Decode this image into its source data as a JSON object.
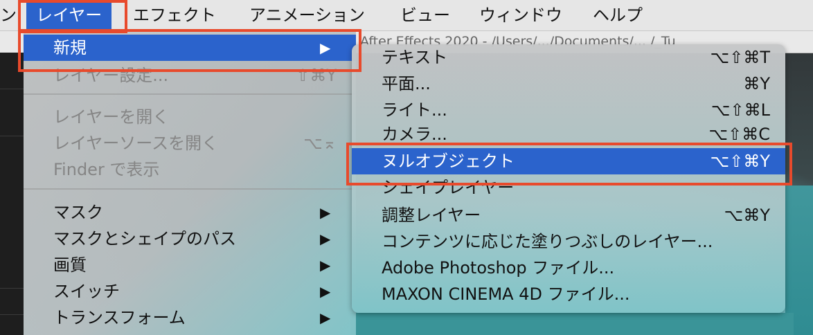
{
  "menubar": {
    "items": [
      {
        "label": "ン"
      },
      {
        "label": "レイヤー"
      },
      {
        "label": "エフェクト"
      },
      {
        "label": "アニメーション"
      },
      {
        "label": "ビュー"
      },
      {
        "label": "ウィンドウ"
      },
      {
        "label": "ヘルプ"
      }
    ]
  },
  "title_strip": {
    "text": "After Effects 2020 - /Users/.../Documents/... /_Tu"
  },
  "layer_menu": {
    "items": [
      {
        "label": "新規",
        "shortcut": "",
        "submenu": true,
        "highlighted": true
      },
      {
        "label": "レイヤー設定...",
        "shortcut": "⇧⌘Y",
        "disabled": true
      },
      {
        "label": "レイヤーを開く",
        "shortcut": "",
        "disabled": true
      },
      {
        "label": "レイヤーソースを開く",
        "shortcut": "⌥⌅",
        "disabled": true
      },
      {
        "label": "Finder で表示",
        "shortcut": "",
        "disabled": true
      },
      {
        "label": "マスク",
        "submenu": true
      },
      {
        "label": "マスクとシェイプのパス",
        "submenu": true
      },
      {
        "label": "画質",
        "submenu": true
      },
      {
        "label": "スイッチ",
        "submenu": true
      },
      {
        "label": "トランスフォーム",
        "submenu": true
      }
    ],
    "arrow": "▶"
  },
  "new_submenu": {
    "items": [
      {
        "label": "テキスト",
        "shortcut": "⌥⇧⌘T"
      },
      {
        "label": "平面...",
        "shortcut": "⌘Y"
      },
      {
        "label": "ライト...",
        "shortcut": "⌥⇧⌘L"
      },
      {
        "label": "カメラ...",
        "shortcut": "⌥⇧⌘C"
      },
      {
        "label": "ヌルオブジェクト",
        "shortcut": "⌥⇧⌘Y",
        "highlighted": true
      },
      {
        "label": "シェイプレイヤー",
        "shortcut": ""
      },
      {
        "label": "調整レイヤー",
        "shortcut": "⌥⌘Y"
      },
      {
        "label": "コンテンツに応じた塗りつぶしのレイヤー...",
        "shortcut": ""
      },
      {
        "label": "Adobe Photoshop ファイル...",
        "shortcut": ""
      },
      {
        "label": "MAXON CINEMA 4D ファイル...",
        "shortcut": ""
      }
    ]
  },
  "colors": {
    "highlight": "#2b63cc",
    "annotation_red": "#e84a2c"
  }
}
